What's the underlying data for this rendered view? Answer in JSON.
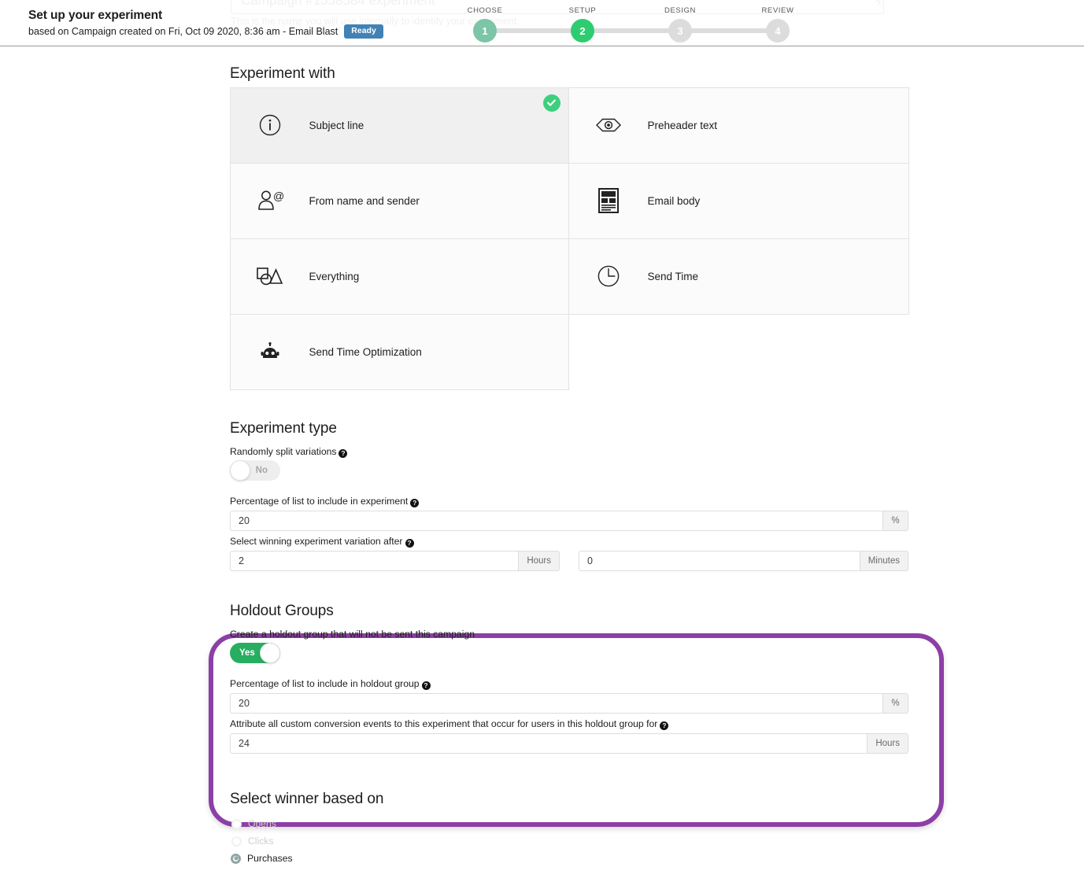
{
  "header": {
    "title": "Set up your experiment",
    "subtitle": "based on Campaign created on Fri, Oct 09 2020, 8:36 am - Email Blast",
    "status_badge": "Ready",
    "background_title": "Campaign #1558584 experiment",
    "background_subtitle": "This is the name you will use internally to identify your experiment."
  },
  "stepper": {
    "steps": [
      {
        "label": "CHOOSE",
        "number": "1",
        "state": "completed",
        "color": "#7cc5a6"
      },
      {
        "label": "SETUP",
        "number": "2",
        "state": "active",
        "color": "#2ecc71"
      },
      {
        "label": "DESIGN",
        "number": "3",
        "state": "upcoming",
        "color": "#dcdcdc"
      },
      {
        "label": "REVIEW",
        "number": "4",
        "state": "upcoming",
        "color": "#dcdcdc"
      }
    ]
  },
  "experiment_with": {
    "title": "Experiment with",
    "cards": [
      {
        "label": "Subject line",
        "icon": "info-circle-icon",
        "selected": true
      },
      {
        "label": "Preheader text",
        "icon": "eye-icon",
        "selected": false
      },
      {
        "label": "From name and sender",
        "icon": "person-at-icon",
        "selected": false
      },
      {
        "label": "Email body",
        "icon": "document-layout-icon",
        "selected": false
      },
      {
        "label": "Everything",
        "icon": "shapes-icon",
        "selected": false
      },
      {
        "label": "Send Time",
        "icon": "clock-icon",
        "selected": false
      },
      {
        "label": "Send Time Optimization",
        "icon": "robot-icon",
        "selected": false
      }
    ]
  },
  "experiment_type": {
    "title": "Experiment type",
    "randomly_split": {
      "label": "Randomly split variations",
      "toggle_value": "No",
      "enabled": false
    },
    "percentage": {
      "label": "Percentage of list to include in experiment",
      "value": "20",
      "suffix": "%"
    },
    "select_winner_after": {
      "label": "Select winning experiment variation after",
      "hours_value": "2",
      "hours_suffix": "Hours",
      "minutes_value": "0",
      "minutes_suffix": "Minutes"
    }
  },
  "holdout_groups": {
    "title": "Holdout Groups",
    "highlight_color": "#8c3fa6",
    "create_holdout": {
      "label": "Create a holdout group that will not be sent this campaign",
      "toggle_value": "Yes",
      "enabled": true
    },
    "percentage": {
      "label": "Percentage of list to include in holdout group",
      "value": "20",
      "suffix": "%"
    },
    "attribution": {
      "label": "Attribute all custom conversion events to this experiment that occur for users in this holdout group for",
      "value": "24",
      "suffix": "Hours"
    }
  },
  "select_winner": {
    "title": "Select winner based on",
    "options": [
      {
        "label": "Opens",
        "selected": false,
        "disabled": true
      },
      {
        "label": "Clicks",
        "selected": false,
        "disabled": true
      },
      {
        "label": "Purchases",
        "selected": true,
        "disabled": false
      }
    ]
  }
}
